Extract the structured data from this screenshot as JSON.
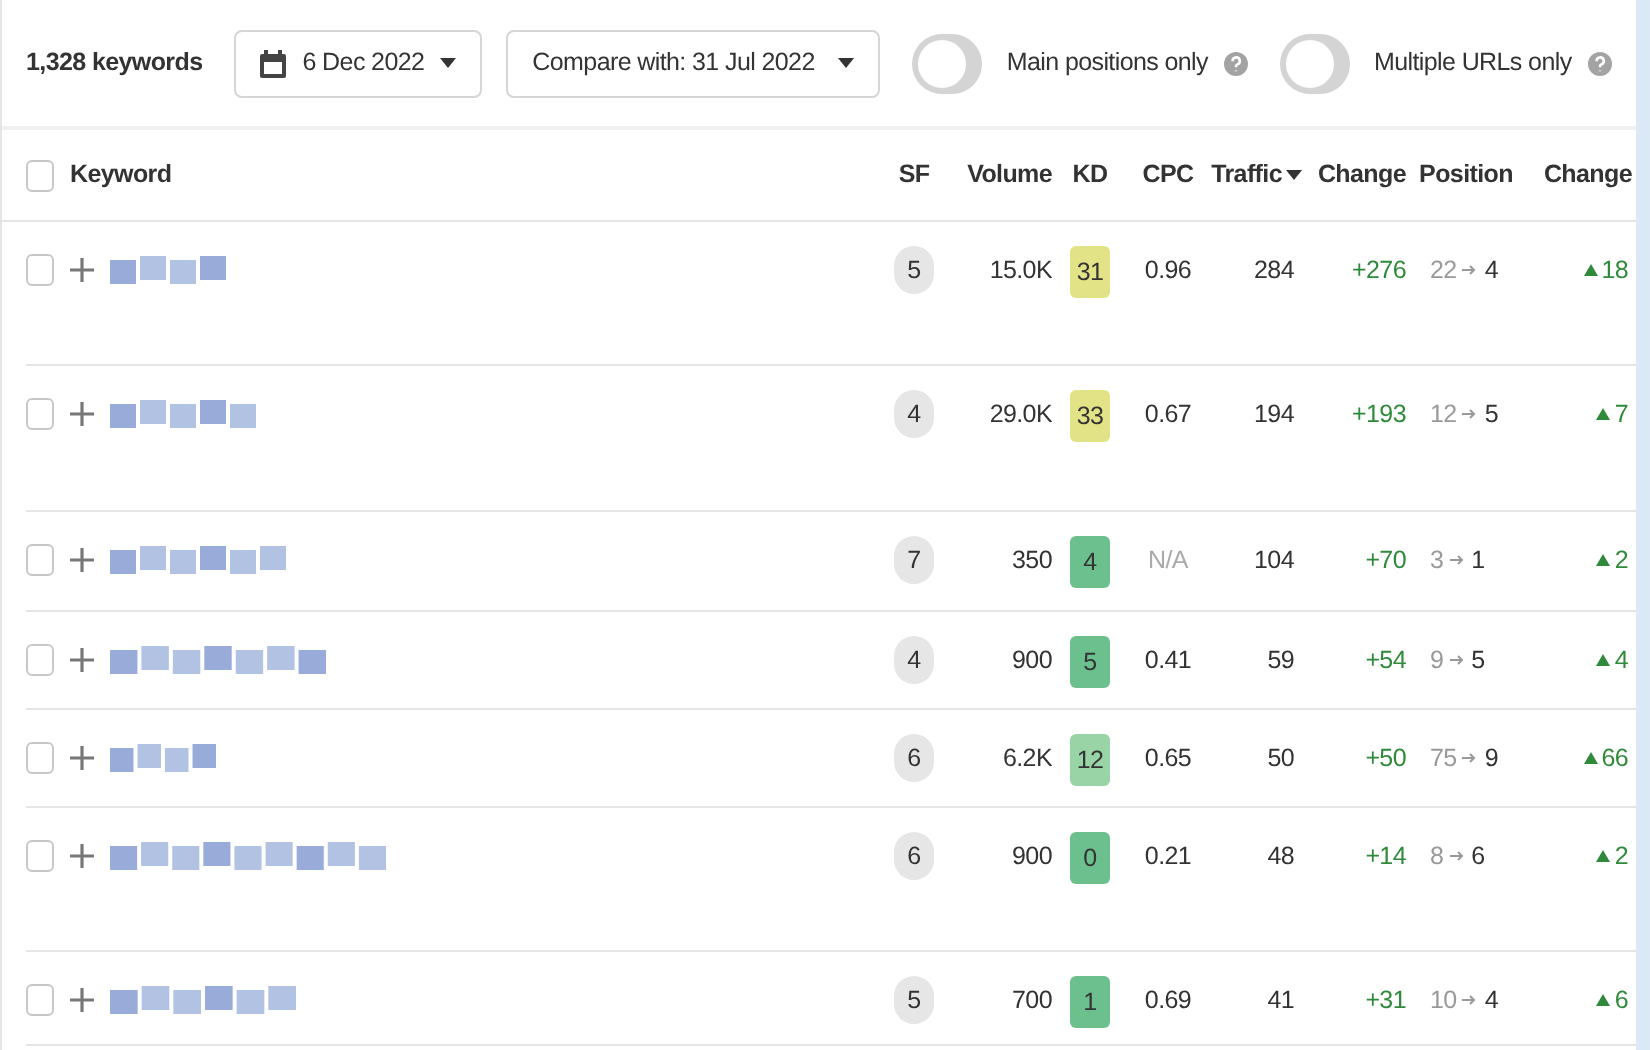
{
  "toolbar": {
    "count": "1,328 keywords",
    "date": "6 Dec 2022",
    "compare": "Compare with: 31 Jul 2022",
    "toggles": [
      {
        "label": "Main positions only",
        "on": false
      },
      {
        "label": "Multiple URLs only",
        "on": false
      }
    ]
  },
  "table": {
    "all_checked": false,
    "columns": [
      "Keyword",
      "SF",
      "Volume",
      "KD",
      "CPC",
      "Traffic",
      "Change",
      "Position",
      "Change"
    ],
    "rows": [
      {
        "checked": false,
        "sf": "5",
        "volume": "15.0K",
        "kd": {
          "value": "31",
          "color": "#e2e287"
        },
        "cpc": "0.96",
        "cpc_available": true,
        "traffic": "284",
        "change": "+276",
        "from": "22",
        "to": "4",
        "delta": "18"
      },
      {
        "checked": false,
        "sf": "4",
        "volume": "29.0K",
        "kd": {
          "value": "33",
          "color": "#e2e287"
        },
        "cpc": "0.67",
        "cpc_available": true,
        "traffic": "194",
        "change": "+193",
        "from": "12",
        "to": "5",
        "delta": "7"
      },
      {
        "checked": false,
        "sf": "7",
        "volume": "350",
        "kd": {
          "value": "4",
          "color": "#6cc08e"
        },
        "cpc": "N/A",
        "cpc_available": false,
        "traffic": "104",
        "change": "+70",
        "from": "3",
        "to": "1",
        "delta": "2"
      },
      {
        "checked": false,
        "sf": "4",
        "volume": "900",
        "kd": {
          "value": "5",
          "color": "#6cc08e"
        },
        "cpc": "0.41",
        "cpc_available": true,
        "traffic": "59",
        "change": "+54",
        "from": "9",
        "to": "5",
        "delta": "4"
      },
      {
        "checked": false,
        "sf": "6",
        "volume": "6.2K",
        "kd": {
          "value": "12",
          "color": "#98d4a5"
        },
        "cpc": "0.65",
        "cpc_available": true,
        "traffic": "50",
        "change": "+50",
        "from": "75",
        "to": "9",
        "delta": "66"
      },
      {
        "checked": false,
        "sf": "6",
        "volume": "900",
        "kd": {
          "value": "0",
          "color": "#6cc08e"
        },
        "cpc": "0.21",
        "cpc_available": true,
        "traffic": "48",
        "change": "+14",
        "from": "8",
        "to": "6",
        "delta": "2"
      },
      {
        "checked": false,
        "sf": "5",
        "volume": "700",
        "kd": {
          "value": "1",
          "color": "#6cc08e"
        },
        "cpc": "0.69",
        "cpc_available": true,
        "traffic": "41",
        "change": "+31",
        "from": "10",
        "to": "4",
        "delta": "6"
      }
    ]
  }
}
